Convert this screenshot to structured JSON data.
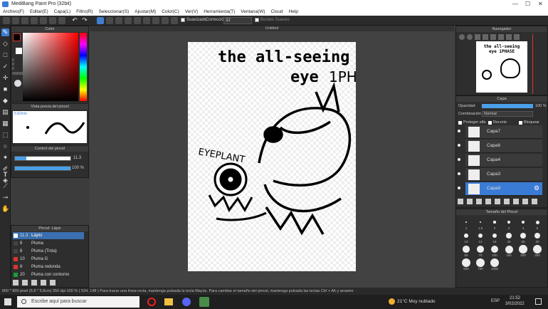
{
  "window": {
    "title": "MediBang Paint Pro (32bit)"
  },
  "menu": [
    "Archivo(F)",
    "Editar(E)",
    "Capa(L)",
    "Filtro(R)",
    "Seleccionar(S)",
    "Ajustar(M)",
    "Color(C)",
    "Ver(V)",
    "Herramienta(T)",
    "Ventana(W)",
    "Cloud",
    "Help"
  ],
  "toolbar": {
    "antialias": "Suavizado",
    "correction_label": "Corrección",
    "correction_value": "32",
    "borders": "Bordes Suaves"
  },
  "canvas_tab": "Untitled",
  "color_panel": {
    "title": "Color",
    "values": [
      "0",
      "0",
      "0"
    ],
    "hex": "#000000"
  },
  "preview_panel": {
    "title": "Vista previa del pincel",
    "size": "5.82mm"
  },
  "control_panel": {
    "title": "Control del pincel",
    "size_value": "11.3",
    "opacity_value": "100 %"
  },
  "brush_panel": {
    "title": "Pincel: Lápiz",
    "items": [
      {
        "size": "11.3",
        "name": "Lápiz",
        "color": "#3a6fb0"
      },
      {
        "size": "8",
        "name": "Pluma",
        "color": "#333333"
      },
      {
        "size": "8",
        "name": "Pluma (Tinta)",
        "color": "#333333"
      },
      {
        "size": "10",
        "name": "Pluma G",
        "color": "#d33"
      },
      {
        "size": "8",
        "name": "Pluma redonda",
        "color": "#d33"
      },
      {
        "size": "20",
        "name": "Pluma con contorno",
        "color": "#1a9c3a"
      }
    ]
  },
  "drawing": {
    "title_line1": "the all-seeing",
    "title_line2": "eye",
    "title_line2b": "1PHASE",
    "side_label": "EYEPLANT"
  },
  "navigator": {
    "title": "Navegador",
    "thumb_text": "the all-seeing eye 1PHASE"
  },
  "layers_panel": {
    "title": "Capa",
    "opacity_label": "Opacidad",
    "opacity_value": "100 %",
    "blend_label": "Combinación",
    "blend_value": "Normal",
    "protect_alpha": "Proteger alfa",
    "clipping": "Recorte",
    "lock": "Bloquear",
    "layers": [
      "Capa7",
      "Capa6",
      "Capa4",
      "Capa3",
      "Capa9"
    ]
  },
  "brushsize_panel": {
    "title": "Tamaño del Pincel",
    "sizes": [
      "1",
      "1.5",
      "2",
      "3",
      "4",
      "5",
      "10",
      "12",
      "15",
      "20",
      "25",
      "30",
      "50",
      "70",
      "100",
      "150",
      "200",
      "300",
      "500",
      "700",
      "1000"
    ]
  },
  "status": "800 * 800 pixel  (5.8 * 5.8cm)  350 dpi  100 %  ( 534, 148 )  Para trazar una línea recta, mantenga pulsada la tecla Mayús. Para cambiar el tamaño del pincel, mantenga pulsada las teclas Ctrl + Alt y arrastre",
  "taskbar": {
    "search_placeholder": "Escribe aquí para buscar",
    "weather": "21°C  Muy nublado",
    "lang": "ESP",
    "time": "21:52",
    "date": "3/02/2022"
  }
}
